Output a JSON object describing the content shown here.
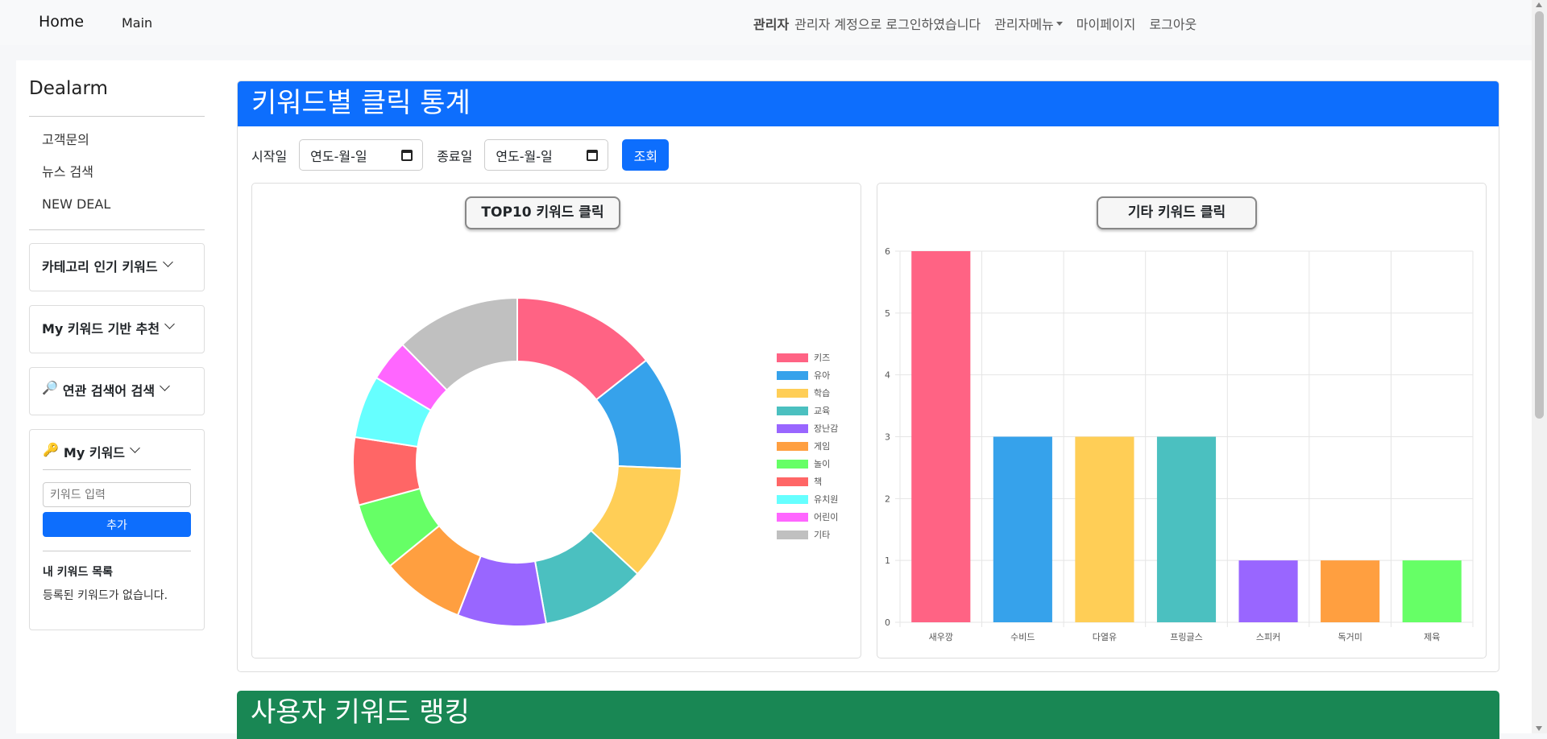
{
  "navbar": {
    "home": "Home",
    "main": "Main",
    "role": "관리자",
    "login_message": "관리자 계정으로 로그인하였습니다",
    "admin_menu": "관리자메뉴",
    "mypage": "마이페이지",
    "logout": "로그아웃"
  },
  "sidebar": {
    "brand": "Dealarm",
    "links": [
      "고객문의",
      "뉴스 검색",
      "NEW DEAL"
    ],
    "accordions": [
      {
        "emoji": "",
        "label": "카테고리 인기 키워드"
      },
      {
        "emoji": "",
        "label": "My 키워드 기반 추천"
      },
      {
        "emoji": "🔎",
        "label": "연관 검색어 검색"
      }
    ],
    "my_keyword": {
      "emoji": "🔑",
      "title": "My 키워드",
      "input_placeholder": "키워드 입력",
      "add_button": "추가",
      "list_title": "내 키워드 목록",
      "empty_message": "등록된 키워드가 없습니다."
    }
  },
  "stats_card": {
    "title": "키워드별 클릭 통계",
    "start_label": "시작일",
    "end_label": "종료일",
    "date_placeholder": "연도-월-일",
    "search_button": "조회"
  },
  "ranking_card": {
    "title": "사용자 키워드 랭킹"
  },
  "colors": {
    "primary": "#0d6efd",
    "success": "#198754"
  },
  "chart_data": [
    {
      "type": "pie",
      "variant": "doughnut",
      "title": "TOP10 키워드 클릭",
      "labels": [
        "키즈",
        "유아",
        "학습",
        "교육",
        "장난감",
        "게임",
        "놀이",
        "책",
        "유치원",
        "어린이",
        "기타"
      ],
      "values": [
        14,
        11,
        11,
        10,
        8.5,
        8,
        6.5,
        6.5,
        6,
        4,
        12
      ],
      "colors": [
        "#ff6384",
        "#36a2eb",
        "#ffce56",
        "#4bc0c0",
        "#9966ff",
        "#ff9f40",
        "#66ff66",
        "#ff6666",
        "#66ffff",
        "#ff66ff",
        "#c0c0c0"
      ],
      "legend": "right"
    },
    {
      "type": "bar",
      "title": "기타 키워드 클릭",
      "categories": [
        "새우깡",
        "수비드",
        "다열유",
        "프링글스",
        "스피커",
        "독거미",
        "제육"
      ],
      "values": [
        6,
        3,
        3,
        3,
        1,
        1,
        1
      ],
      "colors": [
        "#ff6384",
        "#36a2eb",
        "#ffce56",
        "#4bc0c0",
        "#9966ff",
        "#ff9f40",
        "#66ff66"
      ],
      "ylim": [
        0,
        6
      ],
      "yticks": [
        0,
        1,
        2,
        3,
        4,
        5,
        6
      ],
      "grid": true
    }
  ]
}
